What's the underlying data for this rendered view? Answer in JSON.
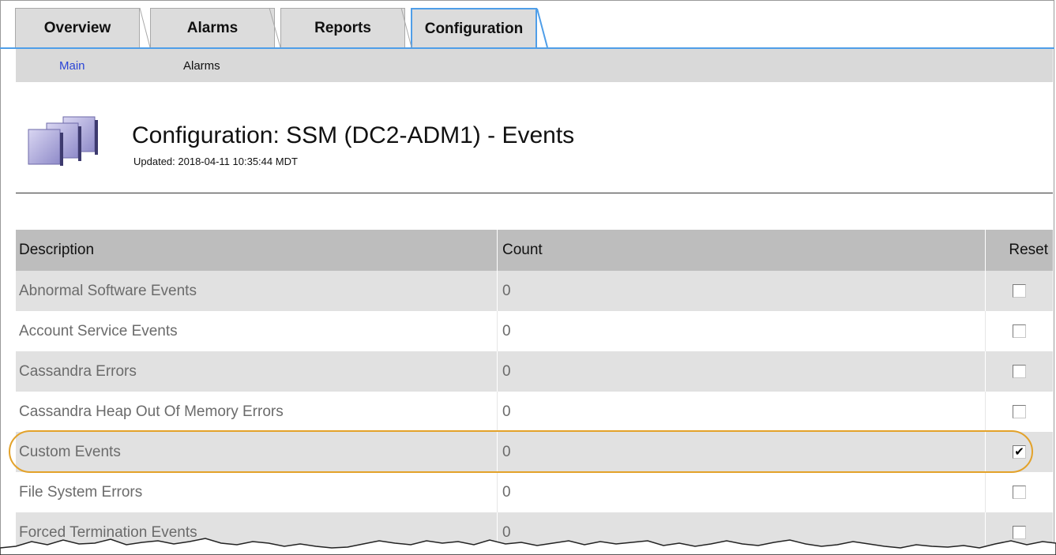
{
  "tabs": [
    {
      "label": "Overview",
      "active": false
    },
    {
      "label": "Alarms",
      "active": false
    },
    {
      "label": "Reports",
      "active": false
    },
    {
      "label": "Configuration",
      "active": true
    }
  ],
  "subnav": [
    {
      "label": "Main",
      "selected": true
    },
    {
      "label": "Alarms",
      "selected": false
    }
  ],
  "header": {
    "icon": "stacked-pages-icon",
    "title": "Configuration: SSM (DC2-ADM1) - Events",
    "updated": "Updated: 2018-04-11 10:35:44 MDT"
  },
  "table": {
    "columns": [
      "Description",
      "Count",
      "Reset"
    ],
    "rows": [
      {
        "description": "Abnormal Software Events",
        "count": "0",
        "reset": false
      },
      {
        "description": "Account Service Events",
        "count": "0",
        "reset": false
      },
      {
        "description": "Cassandra Errors",
        "count": "0",
        "reset": false
      },
      {
        "description": "Cassandra Heap Out Of Memory Errors",
        "count": "0",
        "reset": false
      },
      {
        "description": "Custom Events",
        "count": "0",
        "reset": true,
        "highlighted": true
      },
      {
        "description": "File System Errors",
        "count": "0",
        "reset": false
      },
      {
        "description": "Forced Termination Events",
        "count": "0",
        "reset": false
      }
    ]
  },
  "colors": {
    "tab_accent": "#4f9ee8",
    "subnav_selected": "#2b45d6",
    "highlight_outline": "#e3a22a",
    "header_row": "#bdbdbd",
    "odd_row": "#e1e1e1"
  }
}
